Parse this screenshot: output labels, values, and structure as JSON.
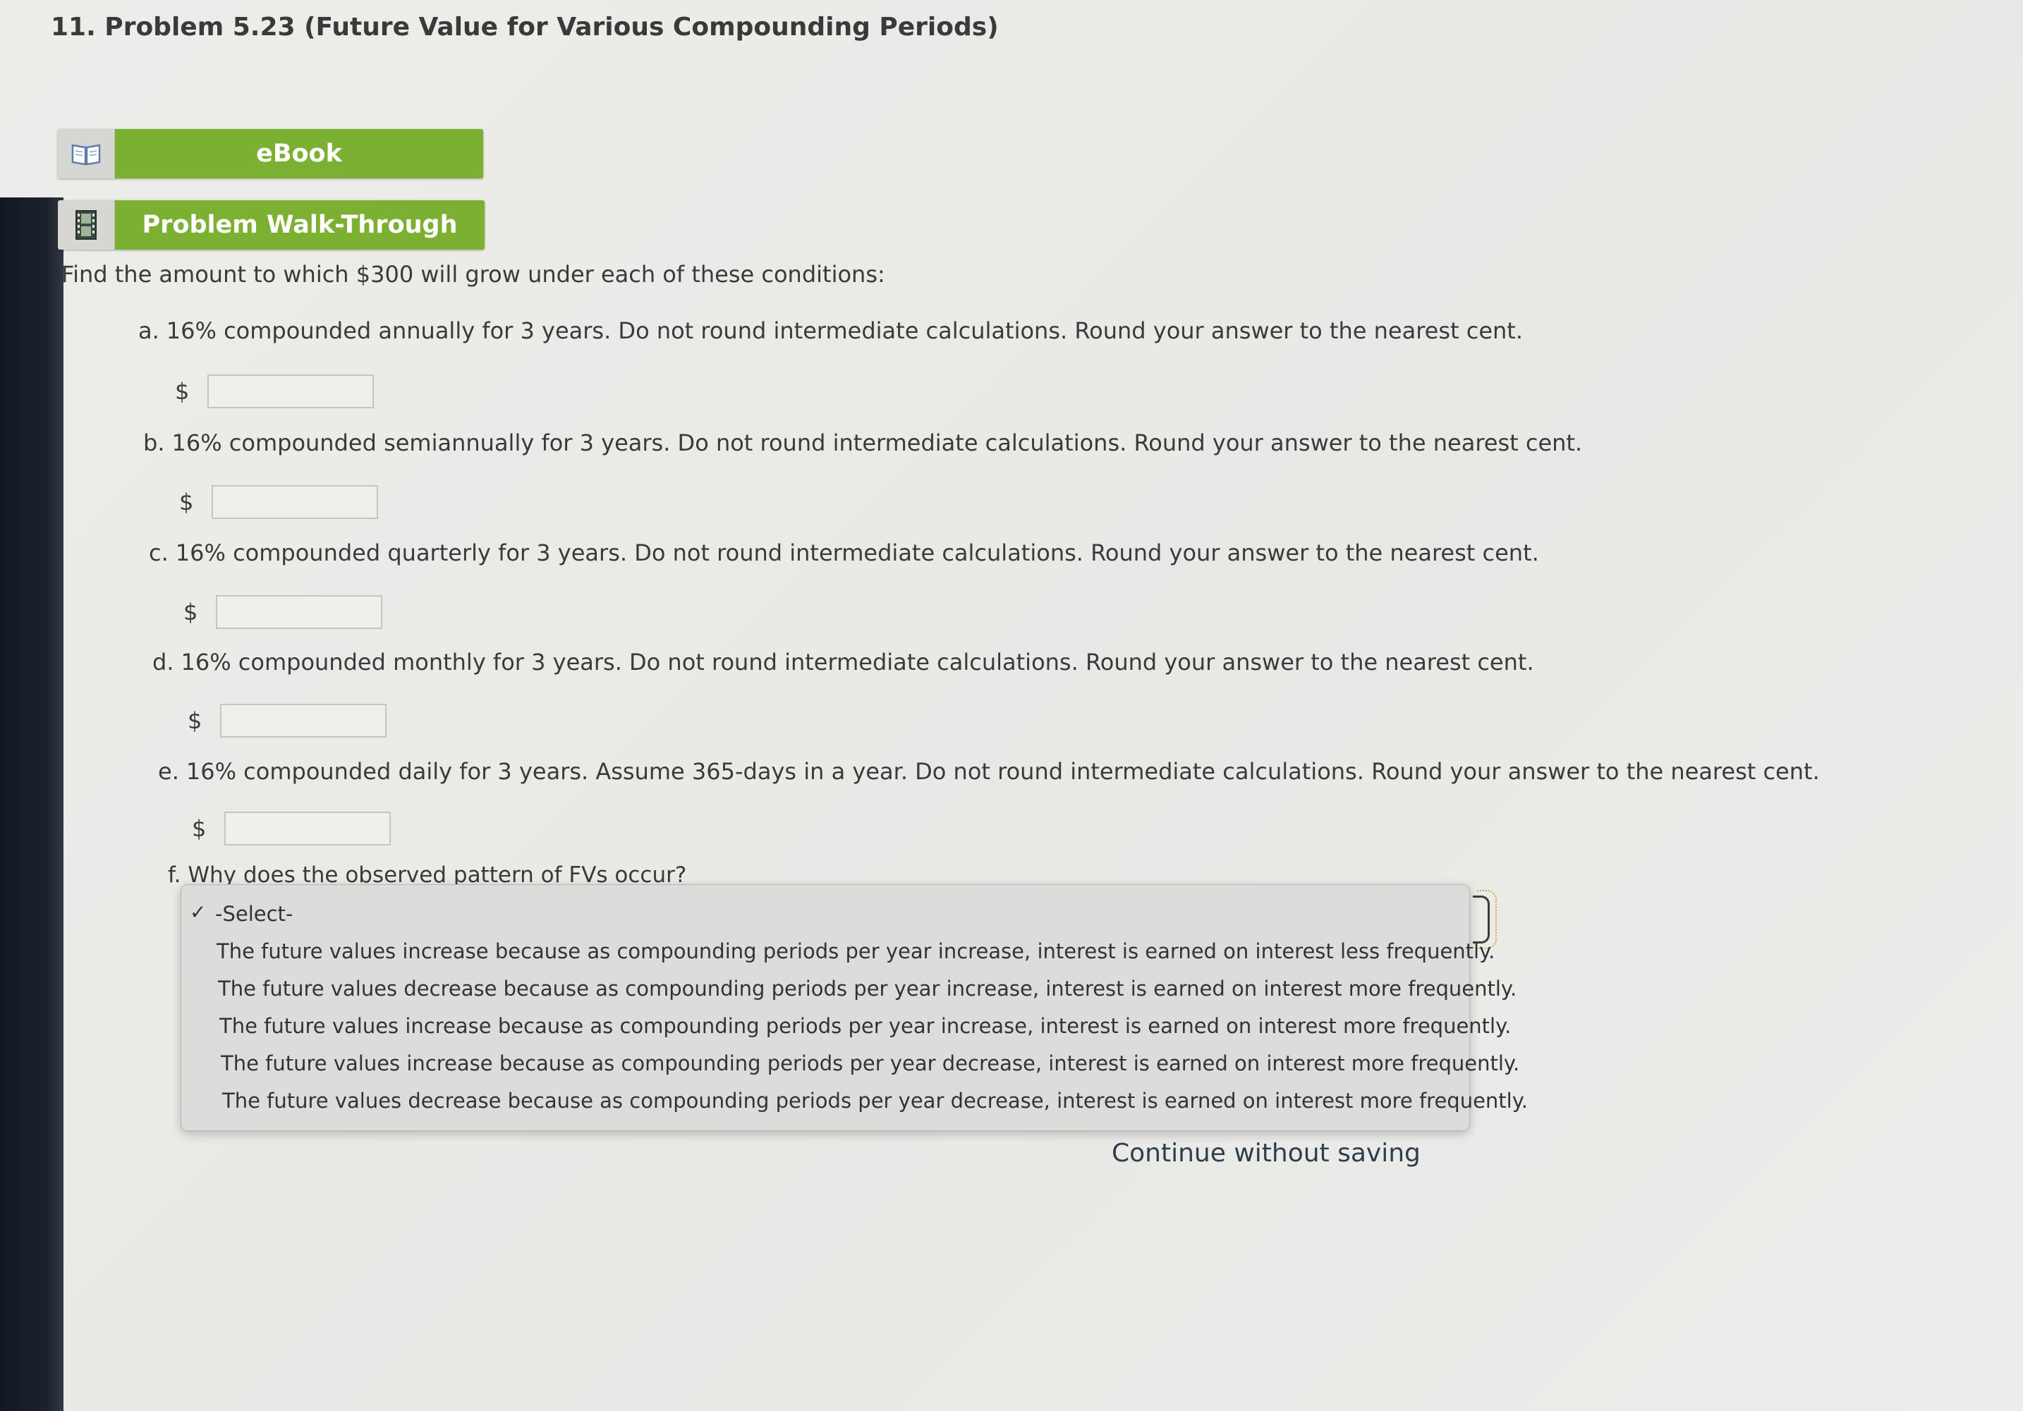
{
  "title": "11. Problem 5.23 (Future Value for Various Compounding Periods)",
  "resources": {
    "ebook_label": "eBook",
    "walkthrough_label": "Problem Walk-Through",
    "ebook_icon": "book-icon",
    "walkthrough_icon": "film-icon"
  },
  "intro": "Find the amount to which $300 will grow under each of these conditions:",
  "currency_symbol": "$",
  "questions": [
    {
      "letter": "a.",
      "text": "16% compounded annually for 3 years. Do not round intermediate calculations. Round your answer to the nearest cent.",
      "value": ""
    },
    {
      "letter": "b.",
      "text": "16% compounded semiannually for 3 years. Do not round intermediate calculations. Round your answer to the nearest cent.",
      "value": ""
    },
    {
      "letter": "c.",
      "text": "16% compounded quarterly for 3 years. Do not round intermediate calculations. Round your answer to the nearest cent.",
      "value": ""
    },
    {
      "letter": "d.",
      "text": "16% compounded monthly for 3 years. Do not round intermediate calculations. Round your answer to the nearest cent.",
      "value": ""
    },
    {
      "letter": "e.",
      "text": "16% compounded daily for 3 years. Assume 365-days in a year. Do not round intermediate calculations. Round your answer to the nearest cent.",
      "value": ""
    }
  ],
  "question_f": {
    "letter": "f.",
    "text": "Why does the observed pattern of FVs occur?"
  },
  "dropdown": {
    "selected_mark": "✓",
    "options": [
      "-Select-",
      "The future values increase because as compounding periods per year increase, interest is earned on interest less frequently.",
      "The future values decrease because as compounding periods per year increase, interest is earned on interest more frequently.",
      "The future values increase because as compounding periods per year increase, interest is earned on interest more frequently.",
      "The future values increase because as compounding periods per year decrease, interest is earned on interest more frequently.",
      "The future values decrease because as compounding periods per year decrease, interest is earned on interest more frequently."
    ]
  },
  "continue_label": "Continue without saving",
  "colors": {
    "button_green": "#7cb032",
    "page_bg": "#ededea",
    "text": "#3a3a3a"
  }
}
